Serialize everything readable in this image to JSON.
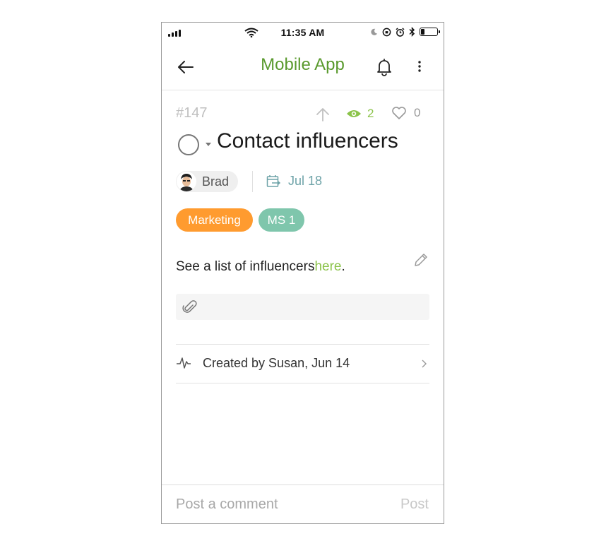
{
  "status_bar": {
    "time": "11:35 AM",
    "battery_level": 0.25
  },
  "header": {
    "title": "Mobile App",
    "back_icon": "arrow-left-icon",
    "bell_icon": "bell-icon",
    "more_icon": "vertical-dots-icon"
  },
  "task": {
    "id": "#147",
    "title": "Contact influencers",
    "views_count": "2",
    "likes_count": "0",
    "assignee": "Brad",
    "due_date": "Jul 18",
    "tags": [
      {
        "label": "Marketing",
        "color": "#ff9b2f"
      },
      {
        "label": "MS 1",
        "color": "#7fc6ac"
      }
    ],
    "description_prefix": "See a list of influencers",
    "description_link": "here",
    "description_suffix": "."
  },
  "activity": {
    "text": "Created by Susan, Jun 14"
  },
  "composer": {
    "placeholder": "Post a comment",
    "post_label": "Post"
  },
  "colors": {
    "accent_green": "#5a9a2e",
    "link_green": "#8bc34a",
    "date_teal": "#6ea3a8"
  }
}
